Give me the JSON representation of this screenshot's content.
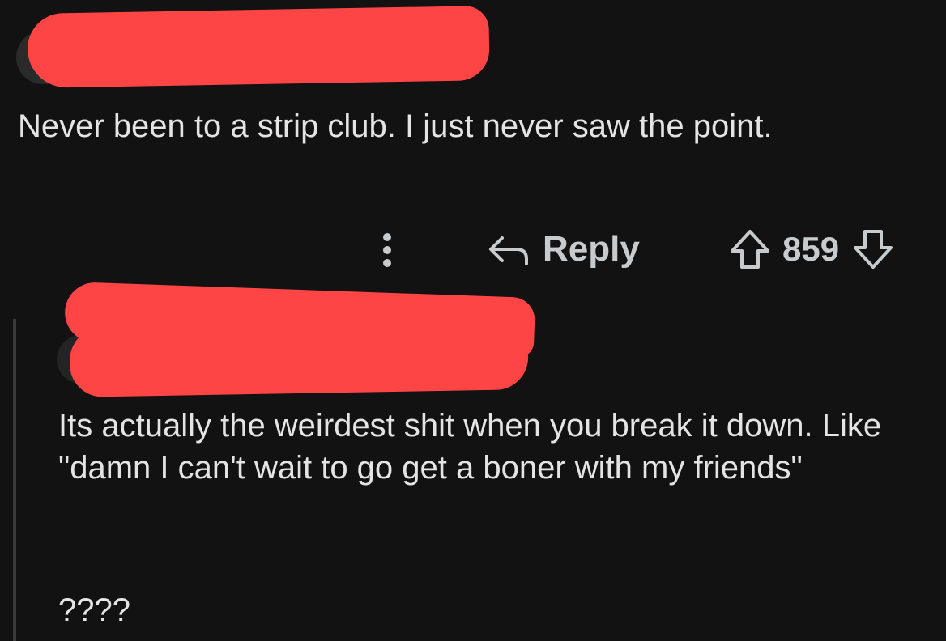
{
  "comments": [
    {
      "body": "Never been to a strip club. I just never saw the point.",
      "actions": {
        "more_icon": "more-vertical-icon",
        "reply_label": "Reply",
        "reply_icon": "reply-arrow-icon",
        "upvote_icon": "upvote-arrow-icon",
        "score": "859",
        "downvote_icon": "downvote-arrow-icon"
      }
    },
    {
      "body": "Its actually the weirdest shit when you break it down. Like \"damn I can't wait to go get a boner with my friends\"",
      "extra": "????"
    }
  ],
  "colors": {
    "background": "#121212",
    "redaction": "#fd4545",
    "text": "#e4e4e4",
    "action_text": "#c8cbcd"
  }
}
